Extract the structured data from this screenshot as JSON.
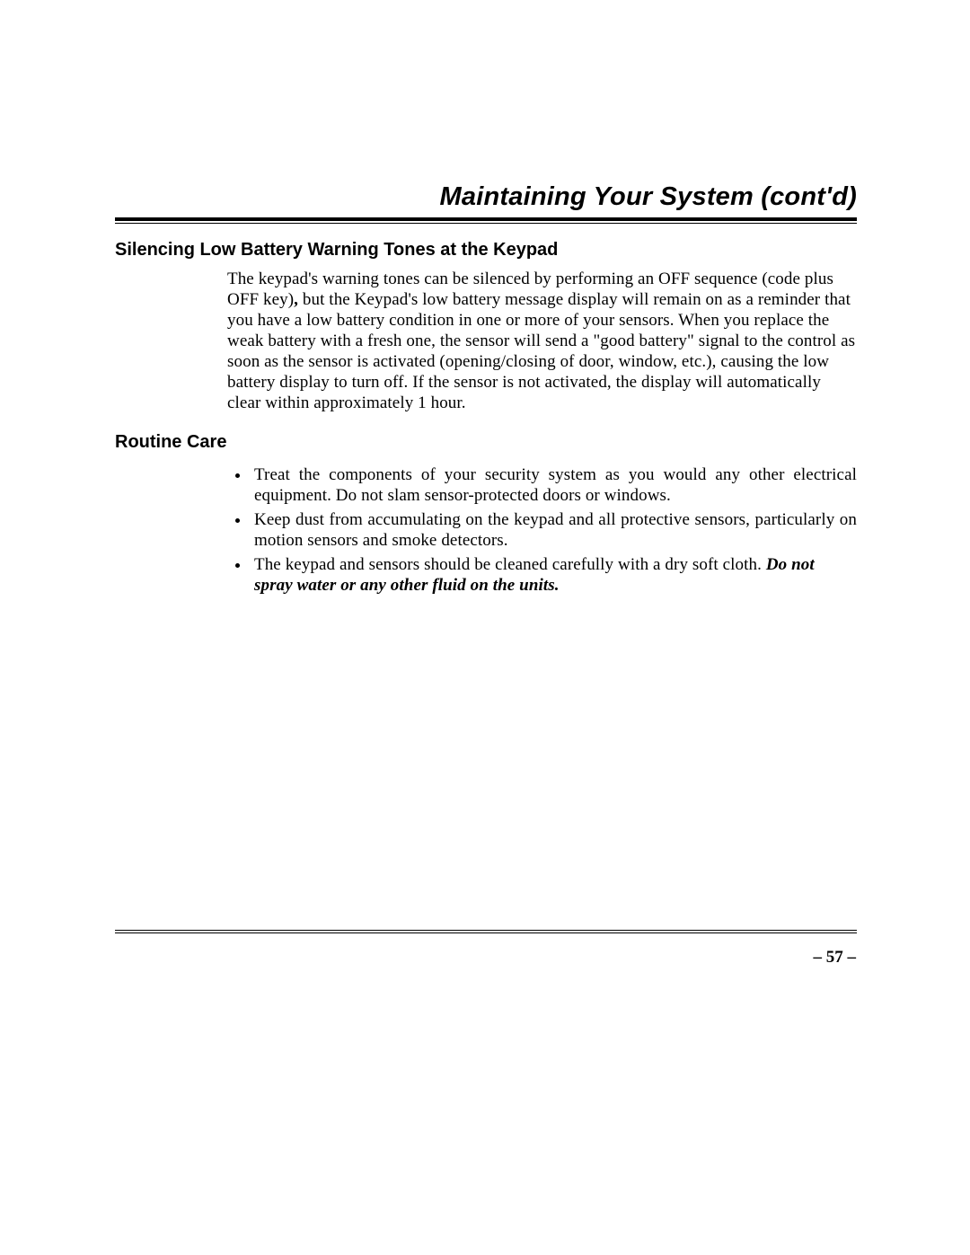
{
  "title": "Maintaining Your System (cont'd)",
  "section1": {
    "heading": "Silencing Low Battery Warning Tones at the Keypad",
    "para_part1": "The keypad's warning tones can be silenced by performing an OFF sequence (code plus OFF key)",
    "comma_bold": ",",
    "para_part2": " but the Keypad's low battery message display will remain on as a reminder that you have a low battery condition in one or more of your sensors. When you replace the weak battery with a fresh one, the sensor will send a \"good battery\" signal to the control as soon as the sensor is activated (opening/closing of door, window, etc.), causing the low battery display to turn off. If the sensor is not activated, the display will automatically clear within approximately 1 hour."
  },
  "section2": {
    "heading": "Routine Care",
    "bullets": [
      "Treat the components of your security system as you would any other electrical equipment. Do not slam sensor-protected doors or windows.",
      "Keep dust from accumulating on the keypad and all protective sensors, particularly on motion sensors and smoke detectors."
    ],
    "bullet3_part1": "The keypad and sensors should be cleaned carefully with a dry soft cloth. ",
    "bullet3_emphasis": "Do not spray water or any other fluid on the units."
  },
  "page_number": "– 57 –"
}
